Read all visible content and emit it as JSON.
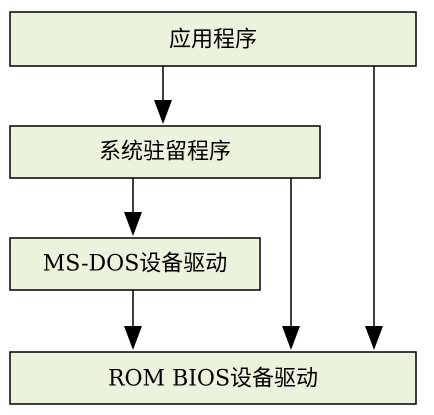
{
  "colors": {
    "box_fill": "#ebf3dc",
    "line": "#000000",
    "text": "#000000"
  },
  "boxes": [
    {
      "id": "app",
      "label": "应用程序"
    },
    {
      "id": "tsr",
      "label": "系统驻留程序"
    },
    {
      "id": "msdos",
      "label": "MS-DOS设备驱动"
    },
    {
      "id": "rombios",
      "label": "ROM BIOS设备驱动"
    }
  ],
  "edges": [
    {
      "from": "app",
      "to": "tsr"
    },
    {
      "from": "app",
      "to": "rombios"
    },
    {
      "from": "tsr",
      "to": "msdos"
    },
    {
      "from": "tsr",
      "to": "rombios"
    },
    {
      "from": "msdos",
      "to": "rombios"
    }
  ]
}
